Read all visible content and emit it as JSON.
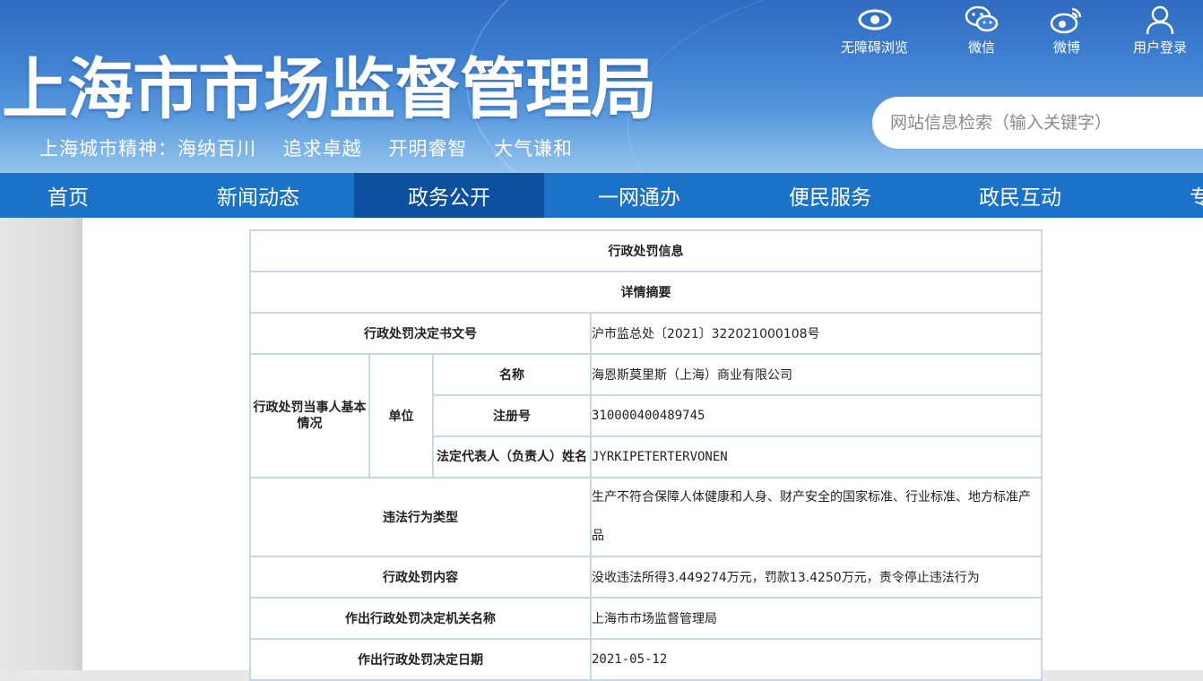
{
  "header": {
    "site_title": "上海市市场监督管理局",
    "spirit": [
      "上海城市精神：海纳百川",
      "追求卓越",
      "开明睿智",
      "大气谦和"
    ],
    "top_links": [
      {
        "label": "无障碍浏览",
        "icon": "eye-icon"
      },
      {
        "label": "微信",
        "icon": "wechat-icon"
      },
      {
        "label": "微博",
        "icon": "weibo-icon"
      },
      {
        "label": "用户登录",
        "icon": "user-icon"
      }
    ],
    "search_placeholder": "网站信息检索（输入关键字）"
  },
  "nav": {
    "items": [
      "首页",
      "新闻动态",
      "政务公开",
      "一网通办",
      "便民服务",
      "政民互动",
      "专题"
    ],
    "active": "政务公开"
  },
  "detail": {
    "title": "行政处罚信息",
    "subtitle": "详情摘要",
    "doc_no_label": "行政处罚决定书文号",
    "doc_no_value": "沪市监总处〔2021〕322021000108号",
    "party_label": "行政处罚当事人基本情况",
    "unit_label": "单位",
    "name_label": "名称",
    "name_value": "海恩斯莫里斯（上海）商业有限公司",
    "reg_label": "注册号",
    "reg_value": "310000400489745",
    "rep_label": "法定代表人（负责人）姓名",
    "rep_value": "JYRKIPETERTERVONEN",
    "violation_label": "违法行为类型",
    "violation_value": "生产不符合保障人体健康和人身、财产安全的国家标准、行业标准、地方标准产品",
    "content_label": "行政处罚内容",
    "content_value": "没收违法所得3.449274万元，罚款13.4250万元，责令停止违法行为",
    "authority_label": "作出行政处罚决定机关名称",
    "authority_value": "上海市市场监督管理局",
    "date_label": "作出行政处罚决定日期",
    "date_value": "2021-05-12"
  },
  "colors": {
    "nav_bg": "#1a73c8",
    "nav_active": "#0d4f9f",
    "table_border": "#c7d8e8"
  }
}
